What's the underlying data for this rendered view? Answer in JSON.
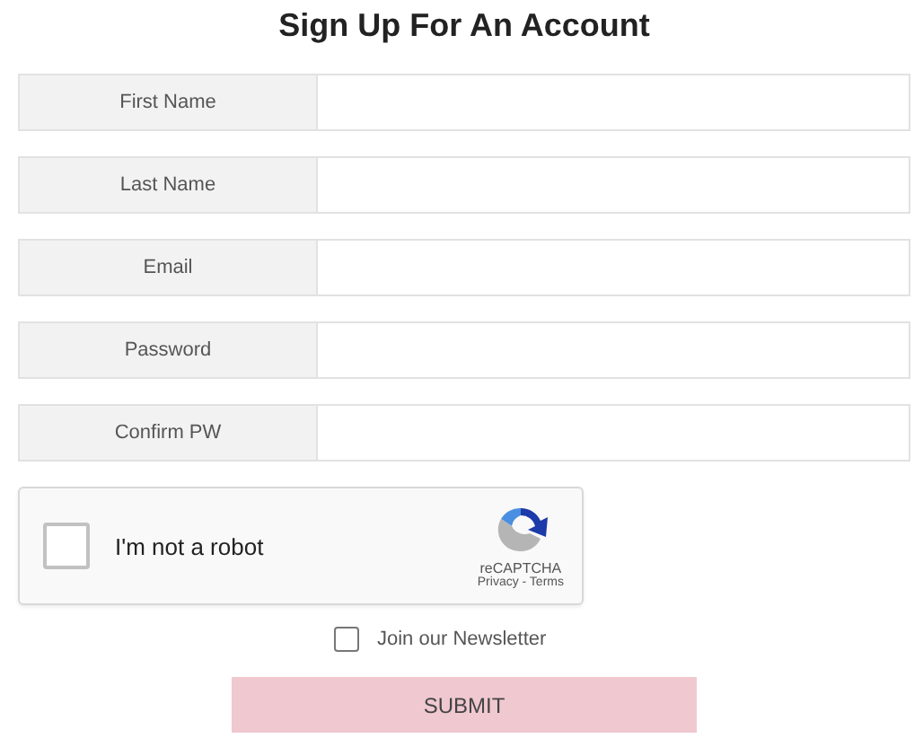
{
  "title": "Sign Up For An Account",
  "fields": [
    {
      "label": "First Name"
    },
    {
      "label": "Last Name"
    },
    {
      "label": "Email"
    },
    {
      "label": "Password"
    },
    {
      "label": "Confirm PW"
    }
  ],
  "captcha": {
    "label": "I'm not a robot",
    "checked": false,
    "brand": "reCAPTCHA",
    "links": "Privacy - Terms"
  },
  "newsletter": {
    "label": "Join our Newsletter",
    "checked": false
  },
  "submit": "SUBMIT"
}
